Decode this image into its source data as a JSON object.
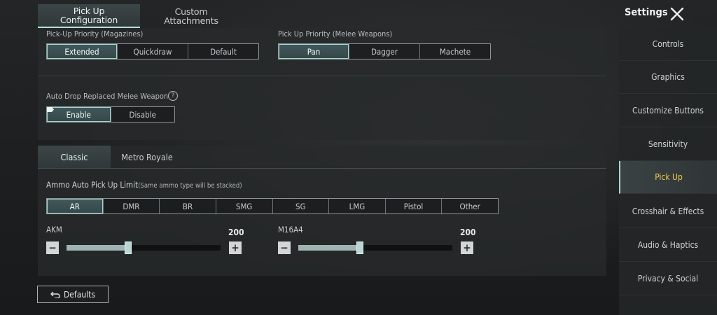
{
  "top_tabs": [
    {
      "label": "Pick Up Configuration",
      "line1": "Pick Up",
      "line2": "Configuration",
      "active": true
    },
    {
      "label": "Custom Attachments",
      "line1": "Custom",
      "line2": "Attachments",
      "active": false
    }
  ],
  "magazines": {
    "label": "Pick-Up Priority (Magazines)",
    "options": [
      "Extended",
      "Quickdraw",
      "Default"
    ],
    "selected": "Extended"
  },
  "melee": {
    "label": "Pick Up Priority (Melee Weapons)",
    "options": [
      "Pan",
      "Dagger",
      "Machete"
    ],
    "selected": "Pan"
  },
  "auto_drop": {
    "label": "Auto Drop Replaced Melee Weapon",
    "help_icon": "?",
    "options": [
      "Enable",
      "Disable"
    ],
    "selected": "Enable"
  },
  "mode_tabs": [
    {
      "label": "Classic",
      "active": true
    },
    {
      "label": "Metro Royale",
      "active": false
    }
  ],
  "ammo": {
    "title": "Ammo Auto Pick Up Limit",
    "note": "(Same ammo type will be stacked)",
    "categories": [
      "AR",
      "DMR",
      "BR",
      "SMG",
      "SG",
      "LMG",
      "Pistol",
      "Other"
    ],
    "selected": "AR"
  },
  "weapons": [
    {
      "name": "AKM",
      "value": "200",
      "level": 0.4
    },
    {
      "name": "M16A4",
      "value": "200",
      "level": 0.4
    }
  ],
  "stepper": {
    "minus": "−",
    "plus": "+"
  },
  "defaults_label": "Defaults",
  "sidebar": {
    "title": "Settings",
    "items": [
      {
        "label": "Controls",
        "active": false
      },
      {
        "label": "Graphics",
        "active": false
      },
      {
        "label": "Customize Buttons",
        "active": false
      },
      {
        "label": "Sensitivity",
        "active": false
      },
      {
        "label": "Pick Up",
        "active": true
      },
      {
        "label": "Crosshair & Effects",
        "active": false
      },
      {
        "label": "Audio & Haptics",
        "active": false
      },
      {
        "label": "Privacy & Social",
        "active": false
      }
    ]
  },
  "colors": {
    "accent_teal": "#a6d8d2",
    "active_sidebar_text": "#f1c84b"
  }
}
